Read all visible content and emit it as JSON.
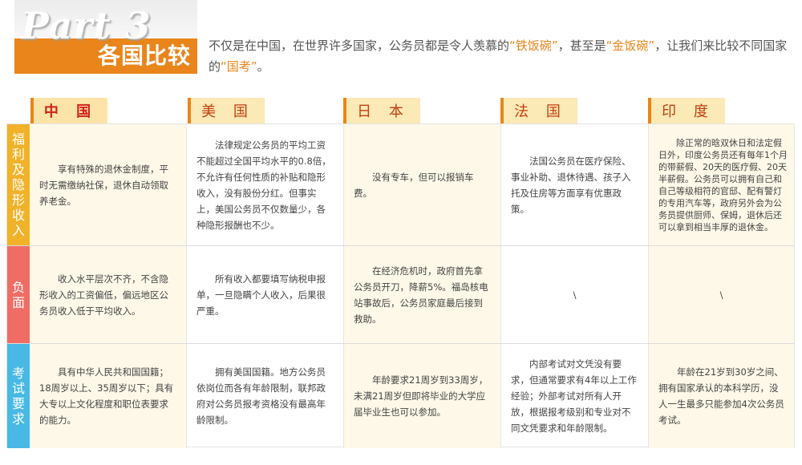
{
  "header": {
    "part_label": "Part 3",
    "title": "各国比较",
    "intro": {
      "t1": "不仅是在中国，在世界许多国家，公务员都是令人羡慕的",
      "q1o": "“",
      "h1": "铁饭碗",
      "q1c": "”",
      "t2": "，甚至是",
      "q2o": "“",
      "h2": "金饭碗",
      "q2c": "”",
      "t3": "，让我们来比较不同国家的",
      "q3o": "“",
      "h3": "国考",
      "q3c": "”",
      "t4": "。"
    }
  },
  "columns": [
    "中 国",
    "美 国",
    "日 本",
    "法 国",
    "印 度"
  ],
  "rows": [
    {
      "label": "福利及隐形收入",
      "color": "#f0b229",
      "cells": [
        "享有特殊的退休金制度，平时无需缴纳社保，退休自动领取养老金。",
        "法律规定公务员的平均工资不能超过全国平均水平的0.8倍，不允许有任何性质的补贴和隐形收入，没有股份分红。但事实上，美国公务员不仅数量少，各种隐形报酬也不少。",
        "没有专车，但可以报销车费。",
        "法国公务员在医疗保险、事业补助、退休待遇、孩子入托及住房等方面享有优惠政策。",
        "除正常的晗双休日和法定假日外，印度公务员还有每年1个月的带薪假、20天的医疗假、20天半薪假。公务员可以拥有自己和自己等级相符的官邸、配有警灯的专用汽车等，政府另外会为公务员提供厨师、保姆，退休后还可以拿到相当丰厚的退休金。"
      ]
    },
    {
      "label": "负面",
      "color": "#ef6d64",
      "cells": [
        "收入水平层次不齐，不含隐形收入的工资偏低，偏远地区公务员收入低于平均收入。",
        "所有收入都要填写纳税申报单，一旦隐瞒个人收入，后果很严重。",
        "在经济危机时，政府首先拿公务员开刀，降薪5%。福岛核电站事故后，公务员家庭最后接到救助。",
        "\\",
        "\\"
      ]
    },
    {
      "label": "考试要求",
      "color": "#47b9e4",
      "cells": [
        "具有中华人民共和国国籍；18周岁以上、35周岁以下；具有大专以上文化程度和职位表要求的能力。",
        "拥有美国国籍。地方公务员依岗位而各有年龄限制，联邦政府对公务员报考资格没有最高年龄限制。",
        "年龄要求21周岁到33周岁，未满21周岁但即将毕业的大学应届毕业生也可以参加。",
        "内部考试对文凭没有要求，但通常要求有4年以上工作经验；外部考试对所有人开放，根据报考级别和专业对不同文凭要求和年龄限制。",
        "年龄在21岁到30岁之间、拥有国家承认的本科学历，没人一生最多只能参加4次公务员考试。"
      ]
    }
  ]
}
